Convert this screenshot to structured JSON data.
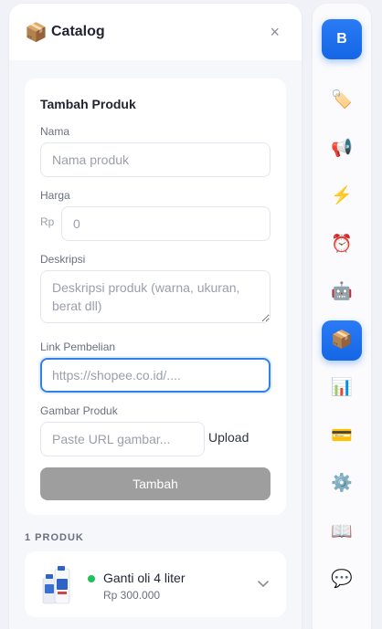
{
  "header": {
    "title": "Catalog",
    "icon": "package-icon",
    "close_glyph": "×"
  },
  "form": {
    "title": "Tambah Produk",
    "name": {
      "label": "Nama",
      "placeholder": "Nama produk",
      "value": ""
    },
    "price": {
      "label": "Harga",
      "prefix": "Rp",
      "placeholder": "0",
      "value": ""
    },
    "description": {
      "label": "Deskripsi",
      "placeholder": "Deskripsi produk (warna, ukuran, berat dll)",
      "value": ""
    },
    "link": {
      "label": "Link Pembelian",
      "placeholder": "https://shopee.co.id/....",
      "value": ""
    },
    "image": {
      "label": "Gambar Produk",
      "placeholder": "Paste URL gambar...",
      "value": "",
      "upload_label": "Upload"
    },
    "submit_label": "Tambah"
  },
  "products": {
    "count_label": "1 PRODUK",
    "items": [
      {
        "name": "Ganti oli 4 liter",
        "price": "Rp 300.000",
        "status_color": "#21c15b"
      }
    ]
  },
  "rail": {
    "avatar_initial": "B",
    "items": [
      {
        "icon": "tag-icon",
        "glyph": "🏷️",
        "active": false
      },
      {
        "icon": "megaphone-icon",
        "glyph": "📢",
        "active": false
      },
      {
        "icon": "lightning-icon",
        "glyph": "⚡",
        "active": false
      },
      {
        "icon": "alarm-clock-icon",
        "glyph": "⏰",
        "active": false
      },
      {
        "icon": "robot-icon",
        "glyph": "🤖",
        "active": false
      },
      {
        "icon": "package-icon",
        "glyph": "📦",
        "active": true
      },
      {
        "icon": "bar-chart-icon",
        "glyph": "📊",
        "active": false
      },
      {
        "icon": "credit-card-icon",
        "glyph": "💳",
        "active": false
      },
      {
        "icon": "gear-icon",
        "glyph": "⚙️",
        "active": false
      },
      {
        "icon": "book-icon",
        "glyph": "📖",
        "active": false
      },
      {
        "icon": "chat-bubble-icon",
        "glyph": "💬",
        "active": false
      }
    ]
  },
  "colors": {
    "accent": "#1466e4",
    "submit_disabled": "#9e9e9e",
    "focus_border": "#2f80ed"
  }
}
